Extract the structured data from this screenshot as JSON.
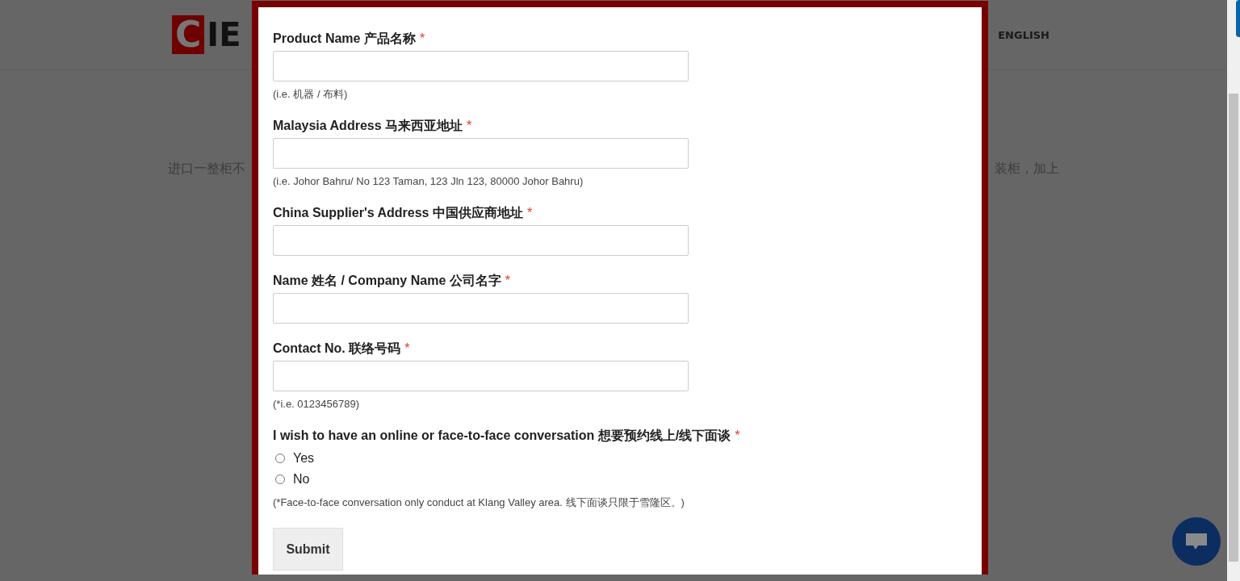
{
  "background_page": {
    "logo_mark": "C",
    "logo_text": "IE",
    "nav_items": [
      "ENGLISH"
    ],
    "intro_left": "进口一整柜不",
    "intro_right": "装柜，加上"
  },
  "form": {
    "fields": [
      {
        "kind": "text",
        "label": "Product Name 产品名称",
        "required_mark": "*",
        "hint": "(i.e. 机器 / 布料)"
      },
      {
        "kind": "text",
        "label": "Malaysia Address 马来西亚地址",
        "required_mark": "*",
        "hint": "(i.e. Johor Bahru/ No 123 Taman, 123 Jln 123, 80000 Johor Bahru)"
      },
      {
        "kind": "text",
        "label": "China Supplier's Address 中国供应商地址",
        "required_mark": "*"
      },
      {
        "kind": "text",
        "label": "Name 姓名 / Company Name 公司名字",
        "required_mark": "*"
      },
      {
        "kind": "text",
        "label": "Contact No. 联络号码",
        "required_mark": "*",
        "hint": "(*i.e. 0123456789)"
      },
      {
        "kind": "radio",
        "label": "I wish to have an online or face-to-face conversation 想要预约线上/线下面谈",
        "required_mark": "*",
        "options": [
          {
            "label": "Yes",
            "selected": false
          },
          {
            "label": "No",
            "selected": false
          }
        ],
        "hint": "(*Face-to-face conversation only conduct at Klang Valley area. 线下面谈只限于雪隆区。)"
      }
    ],
    "submit": "Submit"
  }
}
